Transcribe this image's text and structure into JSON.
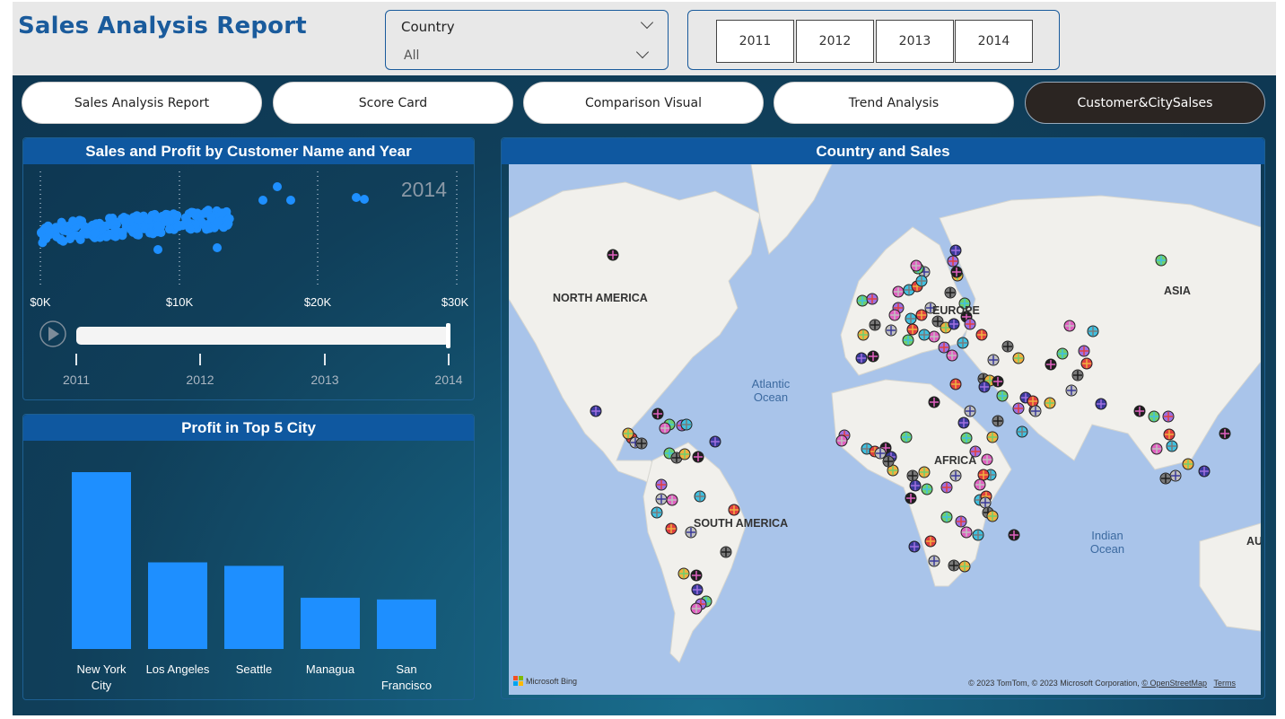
{
  "header": {
    "title": "Sales Analysis Report",
    "country_slicer": {
      "label": "Country",
      "value": "All"
    },
    "year_options": [
      "2011",
      "2012",
      "2013",
      "2014"
    ]
  },
  "nav": [
    {
      "label": "Sales Analysis Report",
      "active": false
    },
    {
      "label": "Score Card",
      "active": false
    },
    {
      "label": "Comparison Visual",
      "active": false
    },
    {
      "label": "Trend Analysis",
      "active": false
    },
    {
      "label": "Customer&CitySalses",
      "active": true
    }
  ],
  "scatter": {
    "title": "Sales and Profit by Customer Name and Year",
    "play_year": "2014",
    "x_ticks": [
      "$0K",
      "$10K",
      "$20K",
      "$30K"
    ],
    "timeline_years": [
      "2011",
      "2012",
      "2013",
      "2014"
    ],
    "color": "#1e8fff"
  },
  "chart_data": {
    "type": "bar",
    "title": "Profit in Top 5 City",
    "categories": [
      "New York City",
      "Los Angeles",
      "Seattle",
      "Managua",
      "San Francisco"
    ],
    "values": [
      100,
      49,
      47,
      29,
      28
    ],
    "color": "#1e8fff"
  },
  "map": {
    "title": "Country and Sales",
    "labels": [
      "NORTH AMERICA",
      "EUROPE",
      "ASIA",
      "AFRICA",
      "SOUTH AMERICA",
      "Atlantic Ocean",
      "Indian Ocean",
      "AU"
    ],
    "bing_logo": "Microsoft Bing",
    "attribution": "© 2023 TomTom, © 2023 Microsoft Corporation,",
    "osm_link": "© OpenStreetMap",
    "terms_link": "Terms"
  }
}
